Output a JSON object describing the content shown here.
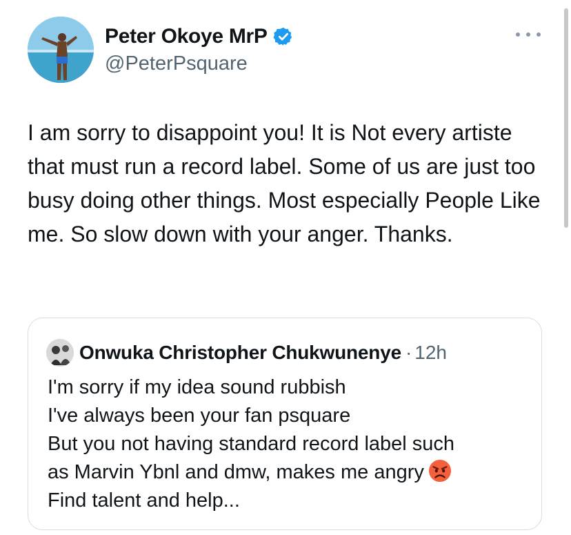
{
  "tweet": {
    "display_name": "Peter Okoye MrP",
    "handle": "@PeterPsquare",
    "verified_icon": "verified-badge-icon",
    "more_icon": "more-options-icon",
    "text": "I am sorry to disappoint you! It is Not every artiste that must run a record label. Some of us are just too busy doing other things. Most especially People Like me. So slow down with your anger. Thanks."
  },
  "quoted_tweet": {
    "display_name": "Onwuka Christopher Chukwunenye",
    "separator": "·",
    "time": "12h",
    "lines": [
      "I'm sorry if my idea sound rubbish",
      "I've always been your fan psquare",
      "But you not having standard record label such",
      "as Marvin Ybnl and dmw, makes me angry",
      "Find talent and help..."
    ],
    "emoji": "angry-face-emoji"
  },
  "colors": {
    "text": "#0f1419",
    "secondary": "#536471",
    "verified": "#1d9bf0",
    "border": "#d6dde2"
  }
}
